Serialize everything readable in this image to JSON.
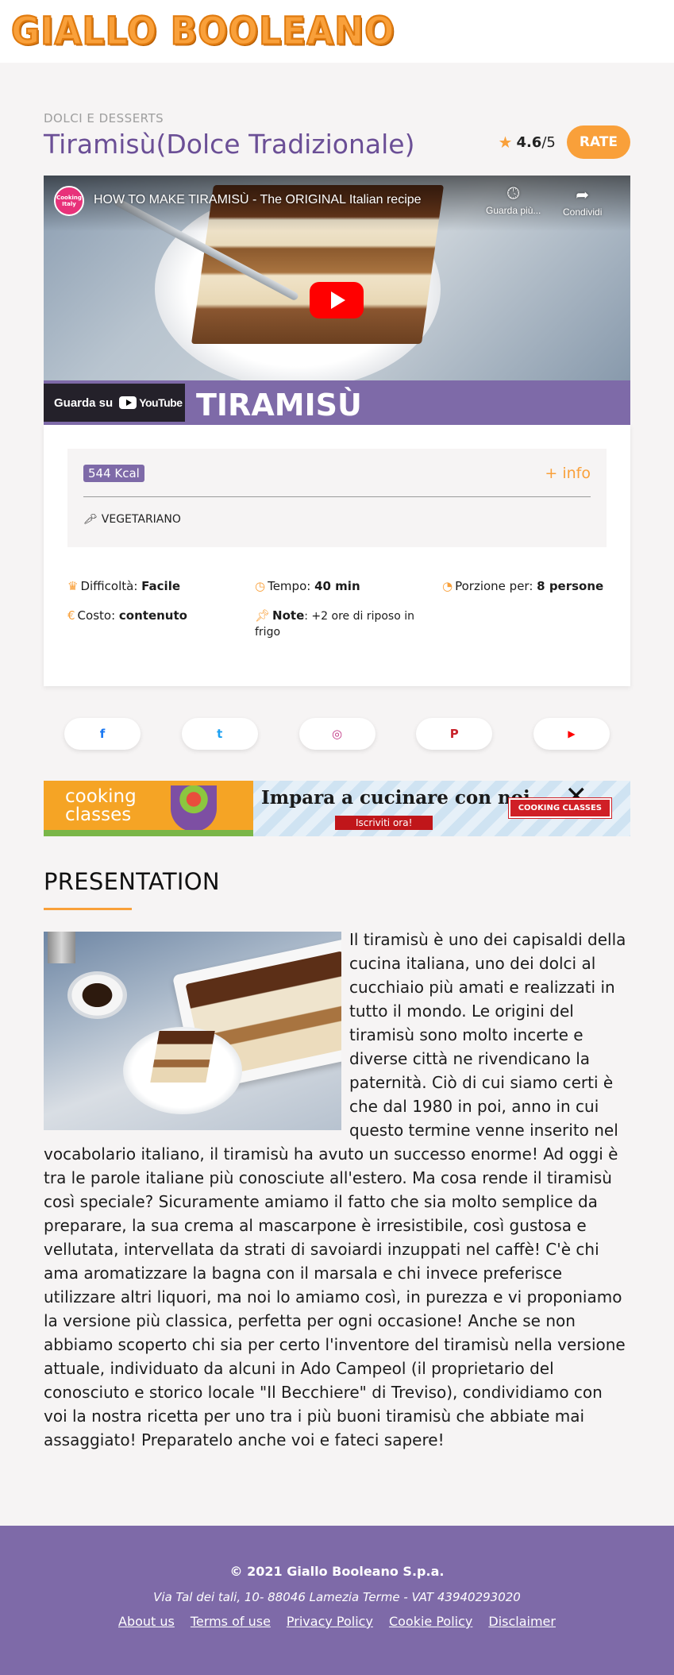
{
  "site": {
    "logo_text": "GIALLO BOOLEANO"
  },
  "recipe": {
    "category": "DOLCI E DESSERTS",
    "title": "Tiramisù(Dolce Tradizionale)",
    "rating_value": "4.6",
    "rating_scale": "/5",
    "rate_label": "RATE"
  },
  "video": {
    "channel_label": "Cooking Italy",
    "title": "HOW TO MAKE TIRAMISÙ - The ORIGINAL Italian recipe",
    "watch_later": "Guarda più...",
    "share": "Condividi",
    "watch_on": "Guarda su",
    "youtube_label": "YouTube",
    "banner_text": "TIRAMISÙ"
  },
  "info": {
    "kcal": "544 Kcal",
    "more_info": "+ info",
    "diet": "VEGETARIANO",
    "difficulty_label": "Difficoltà: ",
    "difficulty_value": "Facile",
    "time_label": "Tempo: ",
    "time_value": "40 min",
    "portion_label": "Porzione per: ",
    "portion_value": "8 persone",
    "cost_label": "Costo: ",
    "cost_value": "contenuto",
    "note_label": "Note",
    "note_value": ": +2 ore di riposo in frigo"
  },
  "social": [
    {
      "icon": "facebook-icon",
      "glyph": "f",
      "color": "#1877f2"
    },
    {
      "icon": "twitter-icon",
      "glyph": "t",
      "color": "#1da1f2"
    },
    {
      "icon": "instagram-icon",
      "glyph": "◎",
      "color": "#c13584"
    },
    {
      "icon": "pinterest-icon",
      "glyph": "P",
      "color": "#c8232c"
    },
    {
      "icon": "youtube-icon",
      "glyph": "▶",
      "color": "#ff0000"
    }
  ],
  "ad": {
    "left_line1": "cooking",
    "left_line2": "classes",
    "title": "Impara a cucinare con noi",
    "cta": "Iscriviti ora!",
    "badge": "COOKING CLASSES"
  },
  "presentation": {
    "heading": "PRESENTATION",
    "text": "Il tiramisù è uno dei capisaldi della cucina italiana, uno dei dolci al cucchiaio più amati e realizzati in tutto il mondo. Le origini del tiramisù sono molto incerte e diverse città ne rivendicano la paternità. Ciò di cui siamo certi è che dal 1980 in poi, anno in cui questo termine venne inserito nel vocabolario italiano, il tiramisù ha avuto un successo enorme! Ad oggi è tra le parole italiane più conosciute all'estero. Ma cosa rende il tiramisù così speciale? Sicuramente amiamo il fatto che sia molto semplice da preparare, la sua crema al mascarpone è irresistibile, così gustosa e vellutata, intervellata da strati di savoiardi inzuppati nel caffè! C'è chi ama aromatizzare la bagna con il marsala e chi invece preferisce utilizzare altri liquori, ma noi lo amiamo così, in purezza e vi proponiamo la versione più classica, perfetta per ogni occasione! Anche se non abbiamo scoperto chi sia per certo l'inventore del tiramisù nella versione attuale, individuato da alcuni in Ado Campeol (il proprietario del conosciuto e storico locale \"Il Becchiere\" di Treviso), condividiamo con voi la nostra ricetta per uno tra i più buoni tiramisù che abbiate mai assaggiato! Preparatelo anche voi e fateci sapere!"
  },
  "footer": {
    "copyright": "© 2021 Giallo Booleano S.p.a.",
    "address": "Via Tal dei tali, 10- 88046 Lamezia Terme - VAT 43940293020",
    "links": [
      "About us",
      "Terms of use",
      "Privacy Policy",
      "Cookie Policy",
      "Disclaimer"
    ]
  },
  "colors": {
    "accent": "#f9a03a",
    "brand_purple": "#7e6aa8",
    "title_purple": "#6b4f96",
    "background": "#f6f4f4"
  }
}
